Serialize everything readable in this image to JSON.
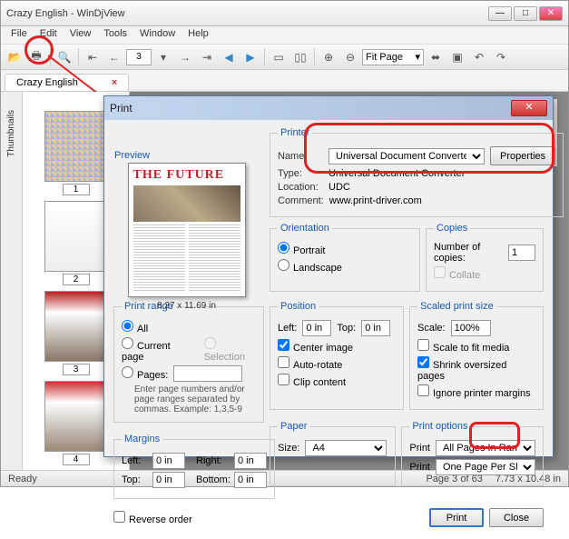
{
  "window": {
    "title": "Crazy English - WinDjView"
  },
  "menu": {
    "file": "File",
    "edit": "Edit",
    "view": "View",
    "tools": "Tools",
    "window": "Window",
    "help": "Help"
  },
  "toolbar": {
    "page": "3",
    "zoom": "Fit Page"
  },
  "tab": {
    "name": "Crazy English",
    "close": "×",
    "opt": "✲ ×"
  },
  "thumbs": {
    "label": "Thumbnails",
    "n1": "1",
    "n2": "2",
    "n3": "3",
    "n4": "4"
  },
  "doc": {
    "bigtitle": "THE FUTURE"
  },
  "status": {
    "ready": "Ready",
    "page": "Page 3 of 63",
    "size": "7.73 x 10.48 in"
  },
  "dlg": {
    "title": "Print",
    "preview": {
      "legend": "Preview",
      "title": "THE FUTURE",
      "dims": "8.27 x 11.69 in"
    },
    "printer": {
      "legend": "Printer",
      "name_l": "Name:",
      "name_v": "Universal Document Converter",
      "props": "Properties",
      "type_l": "Type:",
      "type_v": "Universal Document Converter",
      "loc_l": "Location:",
      "loc_v": "UDC",
      "com_l": "Comment:",
      "com_v": "www.print-driver.com"
    },
    "orient": {
      "legend": "Orientation",
      "portrait": "Portrait",
      "landscape": "Landscape"
    },
    "copies": {
      "legend": "Copies",
      "num_l": "Number of copies:",
      "num_v": "1",
      "collate": "Collate"
    },
    "range": {
      "legend": "Print range",
      "all": "All",
      "cur": "Current page",
      "sel": "Selection",
      "pages": "Pages:",
      "hint": "Enter page numbers and/or page ranges separated by commas. Example: 1,3,5-9"
    },
    "pos": {
      "legend": "Position",
      "left_l": "Left:",
      "left_v": "0 in",
      "top_l": "Top:",
      "top_v": "0 in",
      "center": "Center image",
      "auto": "Auto-rotate",
      "clip": "Clip content"
    },
    "scaled": {
      "legend": "Scaled print size",
      "scale_l": "Scale:",
      "scale_v": "100%",
      "fit": "Scale to fit media",
      "shrink": "Shrink oversized pages",
      "ignore": "Ignore printer margins"
    },
    "margins": {
      "legend": "Margins",
      "left_l": "Left:",
      "left_v": "0 in",
      "right_l": "Right:",
      "right_v": "0 in",
      "top_l": "Top:",
      "top_v": "0 in",
      "bot_l": "Bottom:",
      "bot_v": "0 in"
    },
    "paper": {
      "legend": "Paper",
      "size_l": "Size:",
      "size_v": "A4"
    },
    "popt": {
      "legend": "Print options",
      "p1_l": "Print",
      "p1_v": "All Pages In Range",
      "p2_l": "Print",
      "p2_v": "One Page Per Sheet"
    },
    "reverse": "Reverse order",
    "print_btn": "Print",
    "close_btn": "Close"
  }
}
